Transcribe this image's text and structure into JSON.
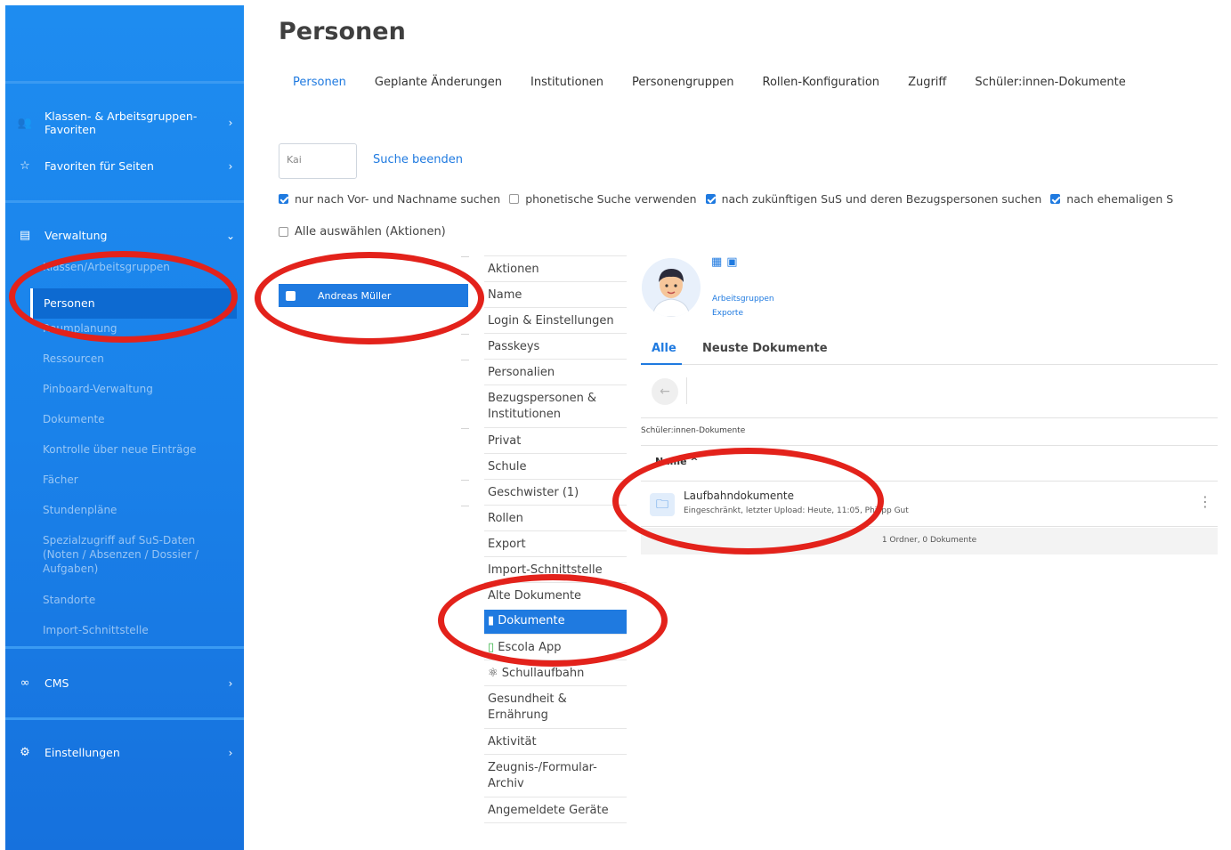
{
  "sidebar": {
    "fav_classes": "Klassen- & Arbeitsgruppen-\nFavoriten",
    "fav_pages": "Favoriten für Seiten",
    "admin": "Verwaltung",
    "sub_items": [
      "Klassen/Arbeitsgruppen",
      "Personen",
      "Raumplanung",
      "Ressourcen",
      "Pinboard-Verwaltung",
      "Dokumente",
      "Kontrolle über neue Einträge",
      "Fächer",
      "Stundenpläne",
      "Spezialzugriff auf SuS-Daten (Noten / Absenzen / Dossier / Aufgaben)",
      "Standorte",
      "Import-Schnittstelle"
    ],
    "cms": "CMS",
    "settings": "Einstellungen"
  },
  "page": {
    "title": "Personen",
    "tabs": [
      "Personen",
      "Geplante Änderungen",
      "Institutionen",
      "Personengruppen",
      "Rollen-Konfiguration",
      "Zugriff",
      "Schüler:innen-Dokumente"
    ]
  },
  "search": {
    "value": "Kai",
    "end_label": "Suche beenden",
    "options": [
      {
        "label": "nur nach Vor- und Nachname suchen",
        "checked": true
      },
      {
        "label": "phonetische Suche verwenden",
        "checked": false
      },
      {
        "label": "nach zukünftigen SuS und deren Bezugspersonen suchen",
        "checked": true
      },
      {
        "label": "nach ehemaligen S",
        "checked": true
      }
    ],
    "select_all": "Alle auswählen (Aktionen)"
  },
  "result": {
    "name": "Andreas Müller"
  },
  "nav": {
    "items": [
      "Aktionen",
      "Name",
      "Login & Einstellungen",
      "Passkeys",
      "Personalien",
      "Bezugspersonen &\nInstitutionen",
      "Privat",
      "Schule",
      "Geschwister (1)",
      "Rollen",
      "Export",
      "Import-Schnittstelle",
      "Alte Dokumente",
      "Dokumente",
      "Escola App",
      "Schullaufbahn",
      "Gesundheit &\nErnährung",
      "Aktivität",
      "Zeugnis-/Formular-\nArchiv",
      "Angemeldete Geräte"
    ],
    "active": "Dokumente"
  },
  "detail": {
    "link_groups": "Arbeitsgruppen",
    "link_exports": "Exporte",
    "sub_tabs": [
      "Alle",
      "Neuste Dokumente"
    ],
    "breadcrumb": "Schüler:innen-Dokumente",
    "sort_label": "Name ^",
    "folder": {
      "name": "Laufbahndokumente",
      "meta": "Eingeschränkt, letzter Upload: Heute, 11:05, Philipp Gut"
    },
    "summary": "1 Ordner, 0 Dokumente"
  },
  "colors": {
    "accent": "#1f7ae0",
    "sidebar": "#1a82ea",
    "annotation": "#e3221b"
  }
}
